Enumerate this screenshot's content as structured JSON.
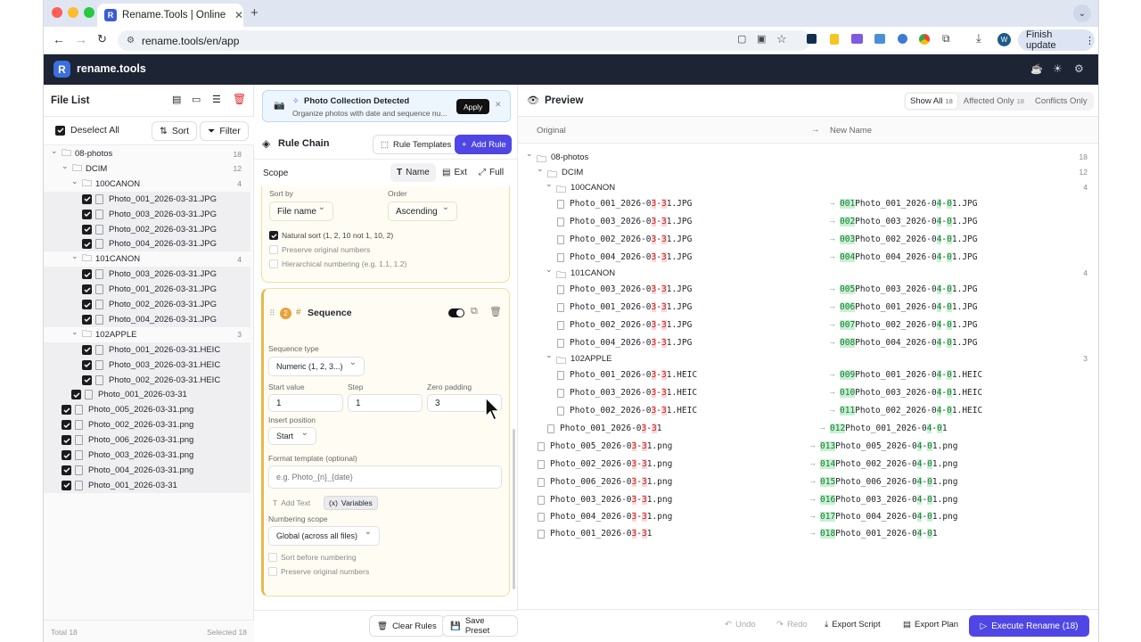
{
  "browser": {
    "tab_title": "Rename.Tools | Online Batch R",
    "favicon_letter": "R",
    "url": "rename.tools/en/app",
    "finish_update": "Finish update",
    "profile_letter": "W"
  },
  "app": {
    "logo_letter": "R",
    "name": "rename.tools"
  },
  "file_list": {
    "title": "File List",
    "deselect_all": "Deselect All",
    "sort": "Sort",
    "filter": "Filter",
    "total": "Total 18",
    "selected": "Selected 18",
    "root": {
      "name": "08-photos",
      "count": "18"
    },
    "dcim": {
      "name": "DCIM",
      "count": "12"
    },
    "f100": {
      "name": "100CANON",
      "count": "4",
      "files": [
        "Photo_001_2026-03-31.JPG",
        "Photo_003_2026-03-31.JPG",
        "Photo_002_2026-03-31.JPG",
        "Photo_004_2026-03-31.JPG"
      ]
    },
    "f101": {
      "name": "101CANON",
      "count": "4",
      "files": [
        "Photo_003_2026-03-31.JPG",
        "Photo_001_2026-03-31.JPG",
        "Photo_002_2026-03-31.JPG",
        "Photo_004_2026-03-31.JPG"
      ]
    },
    "f102": {
      "name": "102APPLE",
      "count": "3",
      "files": [
        "Photo_001_2026-03-31.HEIC",
        "Photo_003_2026-03-31.HEIC",
        "Photo_002_2026-03-31.HEIC"
      ]
    },
    "dcim_file": "Photo_001_2026-03-31",
    "root_files": [
      "Photo_005_2026-03-31.png",
      "Photo_002_2026-03-31.png",
      "Photo_006_2026-03-31.png",
      "Photo_003_2026-03-31.png",
      "Photo_004_2026-03-31.png",
      "Photo_001_2026-03-31"
    ]
  },
  "rules": {
    "banner_title": "Photo Collection Detected",
    "banner_desc": "Organize photos with date and sequence nu...",
    "banner_apply": "Apply",
    "chain_title": "Rule Chain",
    "templates": "Rule Templates",
    "add_rule": "Add Rule",
    "scope": "Scope",
    "scope_name": "Name",
    "scope_ext": "Ext",
    "scope_full": "Full",
    "sort_by_label": "Sort by",
    "sort_by_value": "File name",
    "order_label": "Order",
    "order_value": "Ascending",
    "natural_sort": "Natural sort (1, 2, 10 not 1, 10, 2)",
    "preserve_numbers": "Preserve original numbers",
    "hierarchical": "Hierarchical numbering (e.g. 1.1, 1.2)",
    "seq_index": "2",
    "seq_title": "Sequence",
    "seq_type_label": "Sequence type",
    "seq_type_value": "Numeric (1, 2, 3...)",
    "start_label": "Start value",
    "start_value": "1",
    "step_label": "Step",
    "step_value": "1",
    "pad_label": "Zero padding",
    "pad_value": "3",
    "insert_label": "Insert position",
    "insert_value": "Start",
    "format_label": "Format template (optional)",
    "format_placeholder": "e.g. Photo_{n}_{date}",
    "add_text": "Add Text",
    "variables": "Variables",
    "scope_label": "Numbering scope",
    "scope_value": "Global (across all files)",
    "sort_before": "Sort before numbering",
    "preserve_numbers2": "Preserve original numbers",
    "clear_rules": "Clear Rules",
    "save_preset": "Save Preset"
  },
  "preview": {
    "title": "Preview",
    "show_all": "Show All",
    "show_all_count": "18",
    "affected": "Affected Only",
    "affected_count": "18",
    "conflicts": "Conflicts Only",
    "col_original": "Original",
    "col_new": "New Name",
    "root": {
      "name": "08-photos",
      "count": "18"
    },
    "dcim": {
      "name": "DCIM",
      "count": "12"
    },
    "f100": {
      "name": "100CANON",
      "count": "4"
    },
    "f101": {
      "name": "101CANON",
      "count": "4"
    },
    "f102": {
      "name": "102APPLE",
      "count": "3"
    },
    "rows": [
      {
        "o": [
          "Photo_001_2026-0",
          "3",
          "-",
          "3",
          "1.JPG"
        ],
        "n": [
          "001",
          "Photo_001_2026-0",
          "4",
          "-",
          "0",
          "1.JPG"
        ]
      },
      {
        "o": [
          "Photo_003_2026-0",
          "3",
          "-",
          "3",
          "1.JPG"
        ],
        "n": [
          "002",
          "Photo_003_2026-0",
          "4",
          "-",
          "0",
          "1.JPG"
        ]
      },
      {
        "o": [
          "Photo_002_2026-0",
          "3",
          "-",
          "3",
          "1.JPG"
        ],
        "n": [
          "003",
          "Photo_002_2026-0",
          "4",
          "-",
          "0",
          "1.JPG"
        ]
      },
      {
        "o": [
          "Photo_004_2026-0",
          "3",
          "-",
          "3",
          "1.JPG"
        ],
        "n": [
          "004",
          "Photo_004_2026-0",
          "4",
          "-",
          "0",
          "1.JPG"
        ]
      },
      {
        "o": [
          "Photo_003_2026-0",
          "3",
          "-",
          "3",
          "1.JPG"
        ],
        "n": [
          "005",
          "Photo_003_2026-0",
          "4",
          "-",
          "0",
          "1.JPG"
        ]
      },
      {
        "o": [
          "Photo_001_2026-0",
          "3",
          "-",
          "3",
          "1.JPG"
        ],
        "n": [
          "006",
          "Photo_001_2026-0",
          "4",
          "-",
          "0",
          "1.JPG"
        ]
      },
      {
        "o": [
          "Photo_002_2026-0",
          "3",
          "-",
          "3",
          "1.JPG"
        ],
        "n": [
          "007",
          "Photo_002_2026-0",
          "4",
          "-",
          "0",
          "1.JPG"
        ]
      },
      {
        "o": [
          "Photo_004_2026-0",
          "3",
          "-",
          "3",
          "1.JPG"
        ],
        "n": [
          "008",
          "Photo_004_2026-0",
          "4",
          "-",
          "0",
          "1.JPG"
        ]
      },
      {
        "o": [
          "Photo_001_2026-0",
          "3",
          "-",
          "3",
          "1.HEIC"
        ],
        "n": [
          "009",
          "Photo_001_2026-0",
          "4",
          "-",
          "0",
          "1.HEIC"
        ]
      },
      {
        "o": [
          "Photo_003_2026-0",
          "3",
          "-",
          "3",
          "1.HEIC"
        ],
        "n": [
          "010",
          "Photo_003_2026-0",
          "4",
          "-",
          "0",
          "1.HEIC"
        ]
      },
      {
        "o": [
          "Photo_002_2026-0",
          "3",
          "-",
          "3",
          "1.HEIC"
        ],
        "n": [
          "011",
          "Photo_002_2026-0",
          "4",
          "-",
          "0",
          "1.HEIC"
        ]
      },
      {
        "o": [
          "Photo_001_2026-0",
          "3",
          "-",
          "3",
          "1"
        ],
        "n": [
          "012",
          "Photo_001_2026-0",
          "4",
          "-",
          "0",
          "1"
        ]
      },
      {
        "o": [
          "Photo_005_2026-0",
          "3",
          "-",
          "3",
          "1.png"
        ],
        "n": [
          "013",
          "Photo_005_2026-0",
          "4",
          "-",
          "0",
          "1.png"
        ]
      },
      {
        "o": [
          "Photo_002_2026-0",
          "3",
          "-",
          "3",
          "1.png"
        ],
        "n": [
          "014",
          "Photo_002_2026-0",
          "4",
          "-",
          "0",
          "1.png"
        ]
      },
      {
        "o": [
          "Photo_006_2026-0",
          "3",
          "-",
          "3",
          "1.png"
        ],
        "n": [
          "015",
          "Photo_006_2026-0",
          "4",
          "-",
          "0",
          "1.png"
        ]
      },
      {
        "o": [
          "Photo_003_2026-0",
          "3",
          "-",
          "3",
          "1.png"
        ],
        "n": [
          "016",
          "Photo_003_2026-0",
          "4",
          "-",
          "0",
          "1.png"
        ]
      },
      {
        "o": [
          "Photo_004_2026-0",
          "3",
          "-",
          "3",
          "1.png"
        ],
        "n": [
          "017",
          "Photo_004_2026-0",
          "4",
          "-",
          "0",
          "1.png"
        ]
      },
      {
        "o": [
          "Photo_001_2026-0",
          "3",
          "-",
          "3",
          "1"
        ],
        "n": [
          "018",
          "Photo_001_2026-0",
          "4",
          "-",
          "0",
          "1"
        ]
      }
    ],
    "undo": "Undo",
    "redo": "Redo",
    "export_script": "Export Script",
    "export_plan": "Export Plan",
    "execute": "Execute Rename (18)"
  },
  "colors": {
    "accent": "#4f46e5",
    "appbar": "#1d2433",
    "added": "#c9f0d2",
    "removed": "#fcd6d6"
  }
}
